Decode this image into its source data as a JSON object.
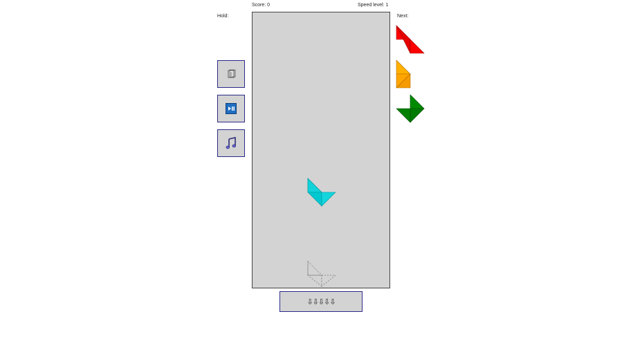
{
  "header": {
    "score_label": "Score: 0",
    "speed_label": "Speed level: 1"
  },
  "hold": {
    "label": "Hold:"
  },
  "next": {
    "label": "Next:",
    "pieces": [
      {
        "color": "#ff0000",
        "shape": "parallelogram"
      },
      {
        "color": "#ffa500",
        "shape": "kite"
      },
      {
        "color": "#008000",
        "shape": "arrow"
      }
    ]
  },
  "board": {
    "background": "#d3d3d3",
    "active_piece": {
      "color": "#00cdd6",
      "shape": "chevron"
    },
    "ghost_piece": {
      "shape": "chevron",
      "style": "dotted"
    }
  },
  "controls": {
    "buttons": [
      {
        "name": "notes-button",
        "icon": "document-icon"
      },
      {
        "name": "play-pause-button",
        "icon": "play-pause-icon"
      },
      {
        "name": "music-button",
        "icon": "music-note-icon"
      }
    ],
    "drop_label": "⇩⇩⇩⇩⇩"
  }
}
